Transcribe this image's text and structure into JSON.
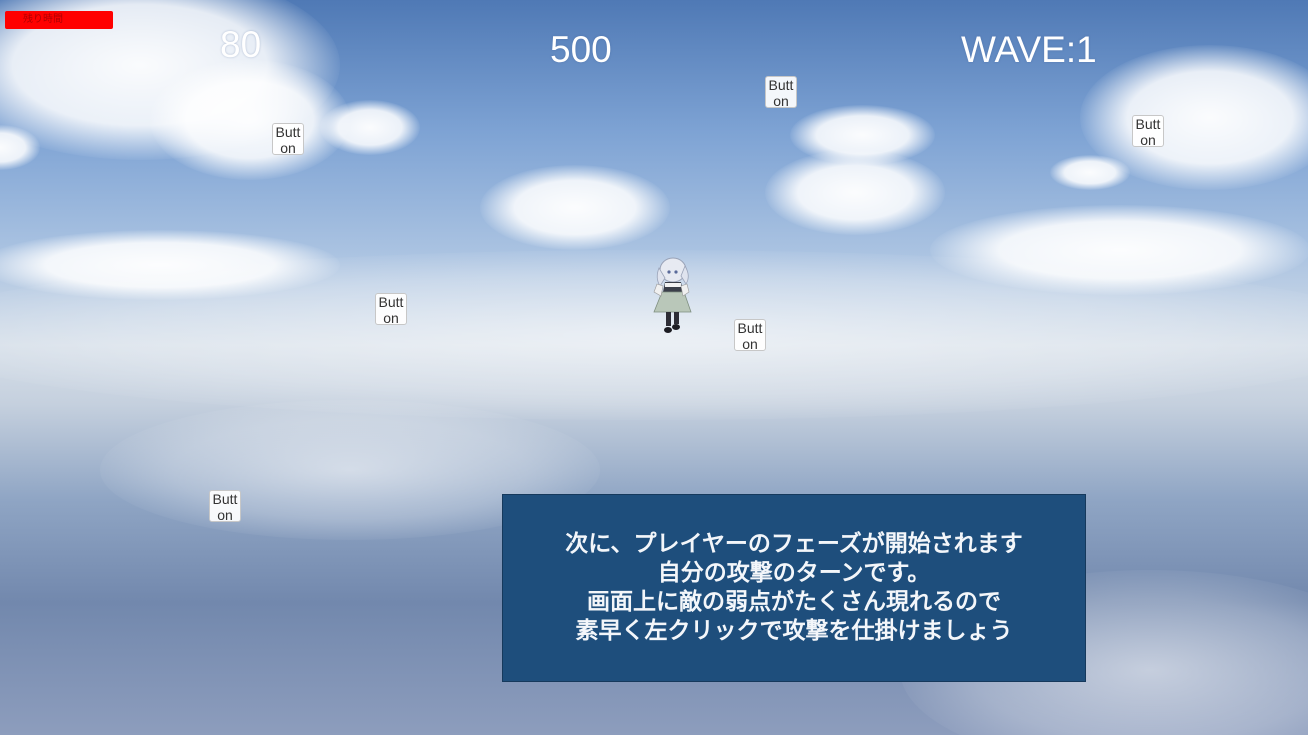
{
  "hud": {
    "hp_label": "残り時間",
    "timer": "80",
    "score": "500",
    "wave": "WAVE:1"
  },
  "weak_points": [
    {
      "label": "Button"
    },
    {
      "label": "Button"
    },
    {
      "label": "Button"
    },
    {
      "label": "Button"
    },
    {
      "label": "Button"
    },
    {
      "label": "Button"
    }
  ],
  "dialog": {
    "lines": [
      "次に、プレイヤーのフェーズが開始されます",
      "自分の攻撃のターンです。",
      "画面上に敵の弱点がたくさん現れるので",
      "素早く左クリックで攻撃を仕掛けましょう"
    ]
  },
  "colors": {
    "hp_bar": "#ff0000",
    "dialog_bg": "#1e4e7c",
    "hud_text": "#ffffff"
  }
}
